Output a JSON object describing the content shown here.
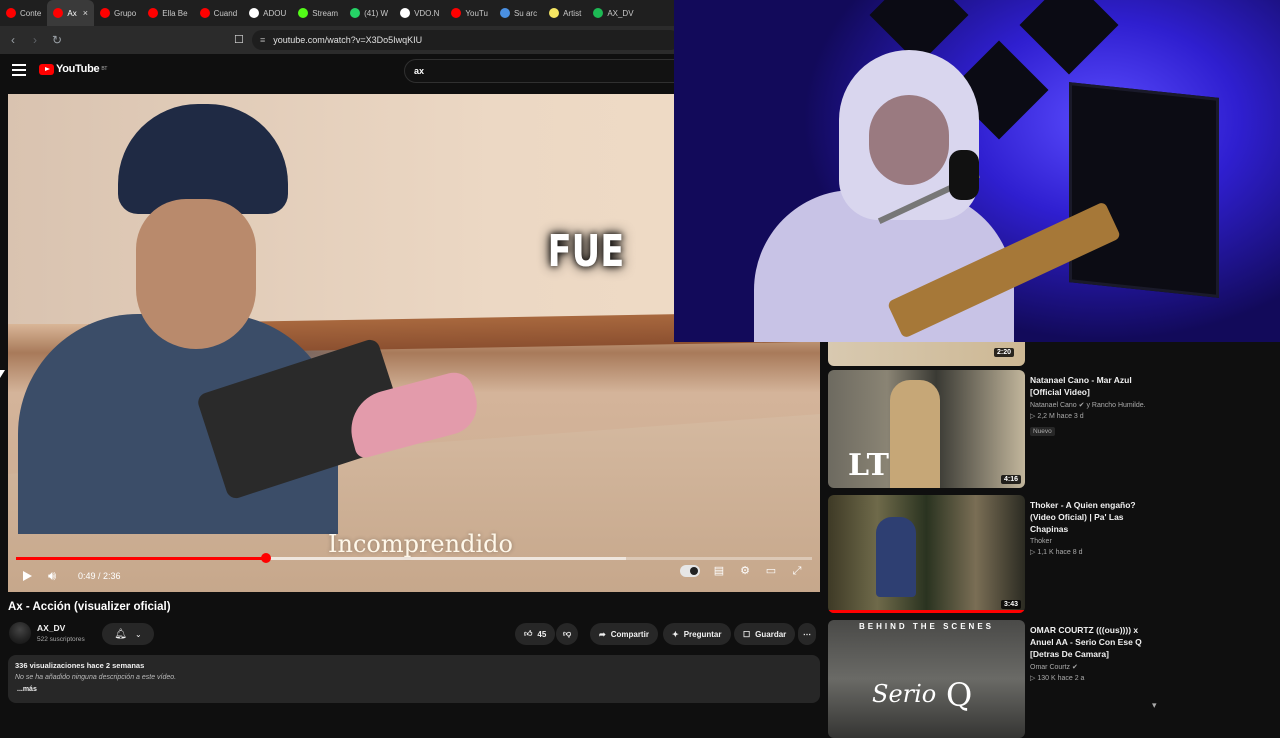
{
  "tabs": [
    {
      "label": "Conte",
      "color": "#ff0000"
    },
    {
      "label": "Ax",
      "color": "#ff0000",
      "active": true
    },
    {
      "label": "Grupo",
      "color": "#ff0000"
    },
    {
      "label": "Ella Be",
      "color": "#ff0000"
    },
    {
      "label": "Cuand",
      "color": "#ff0000"
    },
    {
      "label": "ADOU",
      "color": "#ffffff"
    },
    {
      "label": "Stream",
      "color": "#53fc18"
    },
    {
      "label": "(41) W",
      "color": "#25d366"
    },
    {
      "label": "VDO.N",
      "color": "#ffffff"
    },
    {
      "label": "YouTu",
      "color": "#ff0000"
    },
    {
      "label": "Su arc",
      "color": "#4a90e2"
    },
    {
      "label": "Artist",
      "color": "#f5e663"
    },
    {
      "label": "AX_DV",
      "color": "#1db954"
    }
  ],
  "address": {
    "url": "youtube.com/watch?v=X3Do5IwqKIU"
  },
  "youtube": {
    "logo": "YouTube",
    "region": "BT",
    "search_value": "ax"
  },
  "player": {
    "overlay_word": "FUE",
    "lyric": "Incomprendido",
    "time": "0:49 / 2:36",
    "progress": 0.314
  },
  "video": {
    "title": "Ax - Acción (visualizer oficial)",
    "channel": "AX_DV",
    "subscribers": "522 suscriptores",
    "likes": "45",
    "share": "Compartir",
    "ask": "Preguntar",
    "save": "Guardar",
    "views": "336 visualizaciones  hace 2 semanas",
    "description": "No se ha añadido ninguna descripción a este vídeo.",
    "more": "...más"
  },
  "recommendations": [
    {
      "duration": "2:20"
    },
    {
      "title": "Natanael Cano - Mar Azul [Official Video]",
      "channel": "Natanael Cano ✔ y Rancho Humilde.",
      "meta": "▷ 2,2 M  hace 3 d",
      "badge": "Nuevo",
      "duration": "4:16"
    },
    {
      "title": "Thoker - A Quien engaño? (Video Oficial) | Pa' Las Chapinas",
      "channel": "Thoker",
      "meta": "▷ 1,1 K  hace 8 d",
      "duration": "3:43"
    },
    {
      "title": "OMAR COURTZ (((ous)))) x Anuel AA - Serio Con Ese Q [Detras De Camara]",
      "channel": "Omar Courtz ✔",
      "meta": "▷ 130 K  hace 2 a",
      "thumb_top": "BEHIND THE SCENES",
      "thumb_script": "Serio",
      "thumb_letter": "Q"
    }
  ],
  "icons": {
    "thumb3_logo": "LT"
  }
}
